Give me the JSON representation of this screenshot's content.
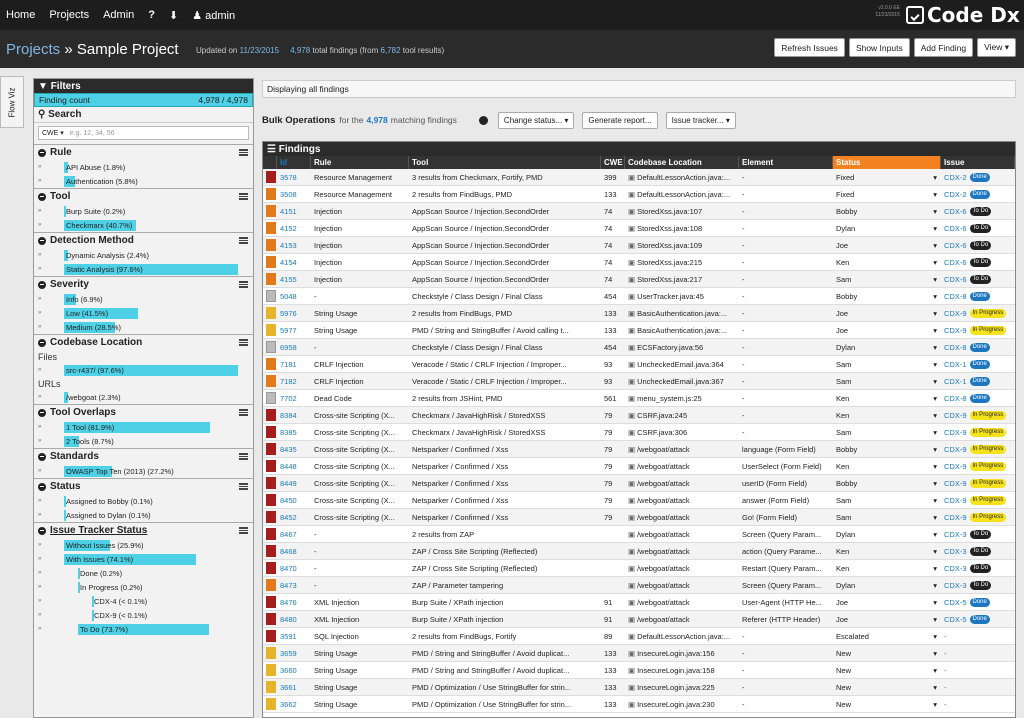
{
  "topnav": {
    "home": "Home",
    "projects": "Projects",
    "admin": "Admin",
    "help": "?",
    "download": "⬇",
    "user": "admin"
  },
  "version": {
    "line1": "v2.0.0 EE",
    "line2": "11/23/2015"
  },
  "logo": {
    "text": "Code Dx"
  },
  "title": {
    "projects": "Projects",
    "sep": "»",
    "project": "Sample Project",
    "updated_prefix": "Updated on",
    "updated_date": "11/23/2015",
    "total": "4,978",
    "total_suffix": "total findings (from",
    "tool_results": "6,782",
    "tool_suffix": "tool results)"
  },
  "header_buttons": [
    "Refresh Issues",
    "Show Inputs",
    "Add Finding",
    "View ▾"
  ],
  "flow_tab": "Flow Viz",
  "filters": {
    "title": "Filters",
    "finding_count_label": "Finding count",
    "finding_count_value": "4,978 / 4,978",
    "search_title": "Search",
    "search_scope": "CWE ▾",
    "search_placeholder": "e.g. 12, 34, 56"
  },
  "sections": {
    "rule": {
      "title": "Rule",
      "items": [
        {
          "label": "API Abuse (1.8%)",
          "frac": 0.02
        },
        {
          "label": "Authentication (5.8%)",
          "frac": 0.06
        }
      ]
    },
    "tool": {
      "title": "Tool",
      "items": [
        {
          "label": "Burp Suite (0.2%)",
          "frac": 0.01
        },
        {
          "label": "Checkmarx (40.7%)",
          "frac": 0.407
        }
      ]
    },
    "detection": {
      "title": "Detection Method",
      "items": [
        {
          "label": "Dynamic Analysis (2.4%)",
          "frac": 0.024
        },
        {
          "label": "Static Analysis (97.6%)",
          "frac": 0.976
        }
      ]
    },
    "severity": {
      "title": "Severity",
      "items": [
        {
          "label": "Info (6.9%)",
          "frac": 0.069
        },
        {
          "label": "Low (41.5%)",
          "frac": 0.415
        },
        {
          "label": "Medium (28.5%)",
          "frac": 0.285
        }
      ]
    },
    "location": {
      "title": "Codebase Location",
      "files_label": "Files",
      "file_item": {
        "label": "src-r437/ (97.6%)",
        "frac": 0.976
      },
      "urls_label": "URLs",
      "url_item": {
        "label": "/webgoat (2.3%)",
        "frac": 0.023
      }
    },
    "overlaps": {
      "title": "Tool Overlaps",
      "items": [
        {
          "label": "1 Tool (81.9%)",
          "frac": 0.819
        },
        {
          "label": "2 Tools (8.7%)",
          "frac": 0.087
        }
      ]
    },
    "standards": {
      "title": "Standards",
      "items": [
        {
          "label": "OWASP Top Ten (2013) (27.2%)",
          "frac": 0.272
        }
      ]
    },
    "status": {
      "title": "Status",
      "items": [
        {
          "label": "Assigned to Bobby (0.1%)",
          "frac": 0.001
        },
        {
          "label": "Assigned to Dylan (0.1%)",
          "frac": 0.001
        }
      ]
    },
    "issuetracker": {
      "title": "Issue Tracker Status",
      "items": [
        {
          "label": "Without Issues (25.9%)",
          "frac": 0.259
        },
        {
          "label": "With Issues (74.1%)",
          "frac": 0.741
        },
        {
          "label": "Done (0.2%)",
          "frac": 0.002
        },
        {
          "label": "In Progress (0.2%)",
          "frac": 0.002
        },
        {
          "label": "CDX-4 (< 0.1%)",
          "frac": 0.0
        },
        {
          "label": "CDX-9 (< 0.1%)",
          "frac": 0.0
        },
        {
          "label": "To Do (73.7%)",
          "frac": 0.737
        }
      ]
    }
  },
  "main": {
    "display_text": "Displaying all findings",
    "bulk_title": "Bulk Operations",
    "bulk_for": "for the",
    "bulk_count": "4,978",
    "bulk_suffix": "matching findings",
    "bulk_buttons": [
      "Change status... ▾",
      "Generate report...",
      "Issue tracker... ▾"
    ],
    "findings_title": "Findings",
    "columns": [
      "Id",
      "Rule",
      "Tool",
      "CWE",
      "Codebase Location",
      "Element",
      "Status",
      "Issue"
    ]
  },
  "rows": [
    {
      "sev": "red",
      "id": "3578",
      "rule": "Resource Management",
      "tool": "3 results from Checkmarx, Fortify, PMD",
      "cwe": "399",
      "loc": "DefaultLessonAction.java:...",
      "el": "-",
      "status": "Fixed",
      "issue": "CDX-2",
      "badge": "Done"
    },
    {
      "sev": "org",
      "id": "3508",
      "rule": "Resource Management",
      "tool": "2 results from FindBugs, PMD",
      "cwe": "133",
      "loc": "DefaultLessonAction.java:...",
      "el": "-",
      "status": "Fixed",
      "issue": "CDX-2",
      "badge": "Done"
    },
    {
      "sev": "org",
      "id": "4151",
      "rule": "Injection",
      "tool": "AppScan Source / Injection.SecondOrder",
      "cwe": "74",
      "loc": "StoredXss.java:107",
      "el": "-",
      "status": "Bobby",
      "issue": "CDX-6",
      "badge": "To Do"
    },
    {
      "sev": "org",
      "id": "4152",
      "rule": "Injection",
      "tool": "AppScan Source / Injection.SecondOrder",
      "cwe": "74",
      "loc": "StoredXss.java:108",
      "el": "-",
      "status": "Dylan",
      "issue": "CDX-6",
      "badge": "To Do"
    },
    {
      "sev": "org",
      "id": "4153",
      "rule": "Injection",
      "tool": "AppScan Source / Injection.SecondOrder",
      "cwe": "74",
      "loc": "StoredXss.java:109",
      "el": "-",
      "status": "Joe",
      "issue": "CDX-6",
      "badge": "To Do"
    },
    {
      "sev": "org",
      "id": "4154",
      "rule": "Injection",
      "tool": "AppScan Source / Injection.SecondOrder",
      "cwe": "74",
      "loc": "StoredXss.java:215",
      "el": "-",
      "status": "Ken",
      "issue": "CDX-6",
      "badge": "To Do"
    },
    {
      "sev": "org",
      "id": "4155",
      "rule": "Injection",
      "tool": "AppScan Source / Injection.SecondOrder",
      "cwe": "74",
      "loc": "StoredXss.java:217",
      "el": "-",
      "status": "Sam",
      "issue": "CDX-6",
      "badge": "To Do"
    },
    {
      "sev": "gry",
      "id": "5048",
      "rule": "-",
      "tool": "Checkstyle / Class Design / Final Class",
      "cwe": "454",
      "loc": "UserTracker.java:45",
      "el": "-",
      "status": "Bobby",
      "issue": "CDX-8",
      "badge": "Done"
    },
    {
      "sev": "yel",
      "id": "5976",
      "rule": "String Usage",
      "tool": "2 results from FindBugs, PMD",
      "cwe": "133",
      "loc": "BasicAuthentication.java:...",
      "el": "-",
      "status": "Joe",
      "issue": "CDX-9",
      "badge": "In Progress"
    },
    {
      "sev": "yel",
      "id": "5977",
      "rule": "String Usage",
      "tool": "PMD / String and StringBuffer / Avoid calling t...",
      "cwe": "133",
      "loc": "BasicAuthentication.java:...",
      "el": "-",
      "status": "Joe",
      "issue": "CDX-9",
      "badge": "In Progress"
    },
    {
      "sev": "gry",
      "id": "6958",
      "rule": "-",
      "tool": "Checkstyle / Class Design / Final Class",
      "cwe": "454",
      "loc": "ECSFactory.java:56",
      "el": "-",
      "status": "Dylan",
      "issue": "CDX-8",
      "badge": "Done"
    },
    {
      "sev": "org",
      "id": "7181",
      "rule": "CRLF Injection",
      "tool": "Veracode / Static / CRLF Injection / Improper...",
      "cwe": "93",
      "loc": "UncheckedEmail.java:364",
      "el": "-",
      "status": "Sam",
      "issue": "CDX-1",
      "badge": "Done"
    },
    {
      "sev": "org",
      "id": "7182",
      "rule": "CRLF Injection",
      "tool": "Veracode / Static / CRLF Injection / Improper...",
      "cwe": "93",
      "loc": "UncheckedEmail.java:367",
      "el": "-",
      "status": "Sam",
      "issue": "CDX-1",
      "badge": "Done"
    },
    {
      "sev": "gry",
      "id": "7702",
      "rule": "Dead Code",
      "tool": "2 results from JSHint, PMD",
      "cwe": "561",
      "loc": "menu_system.js:25",
      "el": "-",
      "status": "Ken",
      "issue": "CDX-8",
      "badge": "Done"
    },
    {
      "sev": "red",
      "id": "8384",
      "rule": "Cross-site Scripting (X...",
      "tool": "Checkmarx / JavaHighRisk / StoredXSS",
      "cwe": "79",
      "loc": "CSRF.java:245",
      "el": "-",
      "status": "Ken",
      "issue": "CDX-9",
      "badge": "In Progress"
    },
    {
      "sev": "red",
      "id": "8385",
      "rule": "Cross-site Scripting (X...",
      "tool": "Checkmarx / JavaHighRisk / StoredXSS",
      "cwe": "79",
      "loc": "CSRF.java:306",
      "el": "-",
      "status": "Sam",
      "issue": "CDX-9",
      "badge": "In Progress"
    },
    {
      "sev": "red",
      "id": "8435",
      "rule": "Cross-site Scripting (X...",
      "tool": "Netsparker / Confirmed / Xss",
      "cwe": "79",
      "loc": "/webgoat/attack",
      "el": "language (Form Field)",
      "status": "Bobby",
      "issue": "CDX-9",
      "badge": "In Progress"
    },
    {
      "sev": "red",
      "id": "8448",
      "rule": "Cross-site Scripting (X...",
      "tool": "Netsparker / Confirmed / Xss",
      "cwe": "79",
      "loc": "/webgoat/attack",
      "el": "UserSelect (Form Field)",
      "status": "Ken",
      "issue": "CDX-9",
      "badge": "In Progress"
    },
    {
      "sev": "red",
      "id": "8449",
      "rule": "Cross-site Scripting (X...",
      "tool": "Netsparker / Confirmed / Xss",
      "cwe": "79",
      "loc": "/webgoat/attack",
      "el": "userID (Form Field)",
      "status": "Bobby",
      "issue": "CDX-9",
      "badge": "In Progress"
    },
    {
      "sev": "red",
      "id": "8450",
      "rule": "Cross-site Scripting (X...",
      "tool": "Netsparker / Confirmed / Xss",
      "cwe": "79",
      "loc": "/webgoat/attack",
      "el": "answer (Form Field)",
      "status": "Sam",
      "issue": "CDX-9",
      "badge": "In Progress"
    },
    {
      "sev": "red",
      "id": "8452",
      "rule": "Cross-site Scripting (X...",
      "tool": "Netsparker / Confirmed / Xss",
      "cwe": "79",
      "loc": "/webgoat/attack",
      "el": "Go! (Form Field)",
      "status": "Sam",
      "issue": "CDX-9",
      "badge": "In Progress"
    },
    {
      "sev": "red",
      "id": "8467",
      "rule": "-",
      "tool": "2 results from ZAP",
      "cwe": "",
      "loc": "/webgoat/attack",
      "el": "Screen (Query Param...",
      "status": "Dylan",
      "issue": "CDX-3",
      "badge": "To Do"
    },
    {
      "sev": "red",
      "id": "8468",
      "rule": "-",
      "tool": "ZAP / Cross Site Scripting (Reflected)",
      "cwe": "",
      "loc": "/webgoat/attack",
      "el": "action (Query Parame...",
      "status": "Ken",
      "issue": "CDX-3",
      "badge": "To Do"
    },
    {
      "sev": "red",
      "id": "8470",
      "rule": "-",
      "tool": "ZAP / Cross Site Scripting (Reflected)",
      "cwe": "",
      "loc": "/webgoat/attack",
      "el": "Restart (Query Param...",
      "status": "Ken",
      "issue": "CDX-3",
      "badge": "To Do"
    },
    {
      "sev": "org",
      "id": "8473",
      "rule": "-",
      "tool": "ZAP / Parameter tampering",
      "cwe": "",
      "loc": "/webgoat/attack",
      "el": "Screen (Query Param...",
      "status": "Dylan",
      "issue": "CDX-3",
      "badge": "To Do"
    },
    {
      "sev": "red",
      "id": "8476",
      "rule": "XML Injection",
      "tool": "Burp Suite / XPath injection",
      "cwe": "91",
      "loc": "/webgoat/attack",
      "el": "User-Agent (HTTP He...",
      "status": "Joe",
      "issue": "CDX-5",
      "badge": "Done"
    },
    {
      "sev": "red",
      "id": "8480",
      "rule": "XML Injection",
      "tool": "Burp Suite / XPath injection",
      "cwe": "91",
      "loc": "/webgoat/attack",
      "el": "Referer (HTTP Header)",
      "status": "Joe",
      "issue": "CDX-5",
      "badge": "Done"
    },
    {
      "sev": "red",
      "id": "3591",
      "rule": "SQL Injection",
      "tool": "2 results from FindBugs, Fortify",
      "cwe": "89",
      "loc": "DefaultLessonAction.java:...",
      "el": "-",
      "status": "Escalated",
      "issue": "-",
      "badge": ""
    },
    {
      "sev": "yel",
      "id": "3659",
      "rule": "String Usage",
      "tool": "PMD / String and StringBuffer / Avoid duplicat...",
      "cwe": "133",
      "loc": "InsecureLogin.java:156",
      "el": "-",
      "status": "New",
      "issue": "-",
      "badge": ""
    },
    {
      "sev": "yel",
      "id": "3660",
      "rule": "String Usage",
      "tool": "PMD / String and StringBuffer / Avoid duplicat...",
      "cwe": "133",
      "loc": "InsecureLogin.java:158",
      "el": "-",
      "status": "New",
      "issue": "-",
      "badge": ""
    },
    {
      "sev": "yel",
      "id": "3661",
      "rule": "String Usage",
      "tool": "PMD / Optimization / Use StringBuffer for strin...",
      "cwe": "133",
      "loc": "InsecureLogin.java:225",
      "el": "-",
      "status": "New",
      "issue": "-",
      "badge": ""
    },
    {
      "sev": "yel",
      "id": "3662",
      "rule": "String Usage",
      "tool": "PMD / Optimization / Use StringBuffer for strin...",
      "cwe": "133",
      "loc": "InsecureLogin.java:230",
      "el": "-",
      "status": "New",
      "issue": "-",
      "badge": ""
    }
  ],
  "colors": {
    "accent": "#4ed1e6",
    "status_col": "#f58220",
    "link": "#1a7ac0"
  }
}
